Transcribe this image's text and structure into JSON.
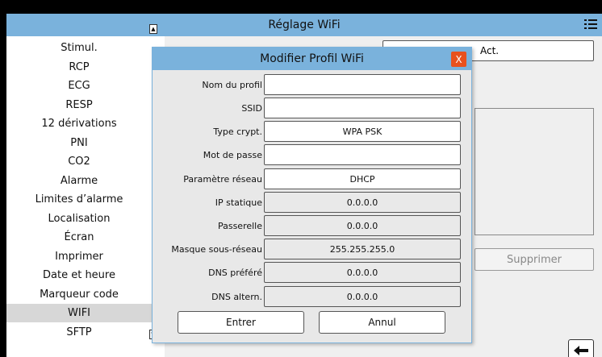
{
  "window": {
    "title": "Réglage WiFi"
  },
  "sidebar": {
    "items": [
      {
        "label": "Stimul."
      },
      {
        "label": "RCP"
      },
      {
        "label": "ECG"
      },
      {
        "label": "RESP"
      },
      {
        "label": "12 dérivations"
      },
      {
        "label": "PNI"
      },
      {
        "label": "CO2"
      },
      {
        "label": "Alarme"
      },
      {
        "label": "Limites d’alarme"
      },
      {
        "label": "Localisation"
      },
      {
        "label": "Écran"
      },
      {
        "label": "Imprimer"
      },
      {
        "label": "Date et heure"
      },
      {
        "label": "Marqueur code"
      },
      {
        "label": "WIFI",
        "selected": true
      },
      {
        "label": "SFTP"
      }
    ]
  },
  "background": {
    "act_value": "Act.",
    "delete_label": "Supprimer"
  },
  "dialog": {
    "title": "Modifier Profil WiFi",
    "close_label": "X",
    "fields": [
      {
        "label": "Nom du profil",
        "value": "",
        "readonly": false
      },
      {
        "label": "SSID",
        "value": "",
        "readonly": false
      },
      {
        "label": "Type crypt.",
        "value": "WPA PSK",
        "readonly": false
      },
      {
        "label": "Mot de passe",
        "value": "",
        "readonly": false
      },
      {
        "label": "Paramètre réseau",
        "value": "DHCP",
        "readonly": false
      },
      {
        "label": "IP statique",
        "value": "0.0.0.0",
        "readonly": true
      },
      {
        "label": "Passerelle",
        "value": "0.0.0.0",
        "readonly": true
      },
      {
        "label": "Masque sous-réseau",
        "value": "255.255.255.0",
        "readonly": true
      },
      {
        "label": "DNS préféré",
        "value": "0.0.0.0",
        "readonly": true
      },
      {
        "label": "DNS altern.",
        "value": "0.0.0.0",
        "readonly": true
      }
    ],
    "ok_label": "Entrer",
    "cancel_label": "Annul"
  },
  "icons": {
    "menu": "menu-icon",
    "back": "back-arrow-icon",
    "scroll_up": "scroll-up-icon",
    "scroll_down": "scroll-down-icon"
  },
  "colors": {
    "titlebar": "#7ab2dc",
    "close": "#e8511e",
    "selected": "#d7d7d7"
  }
}
